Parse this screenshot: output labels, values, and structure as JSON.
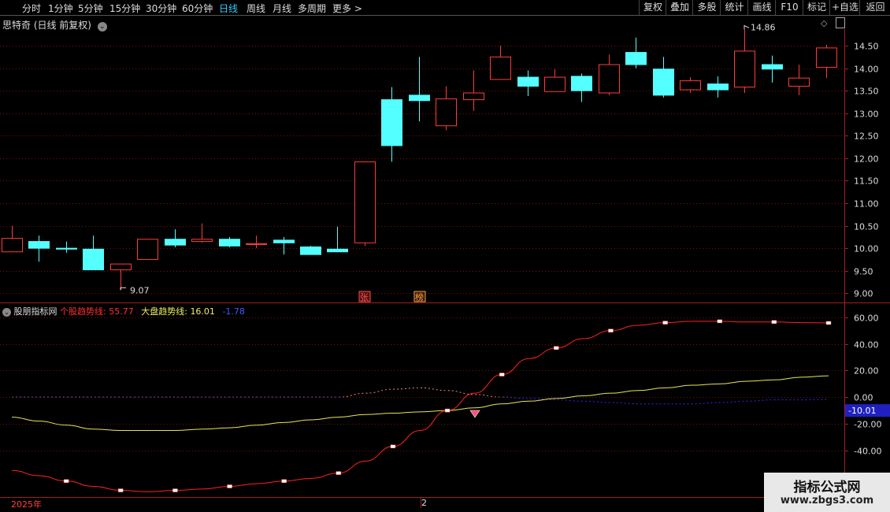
{
  "toolbar": {
    "periods": [
      "分时",
      "1分钟",
      "5分钟",
      "15分钟",
      "30分钟",
      "60分钟",
      "日线",
      "周线",
      "月线",
      "多周期",
      "更多"
    ],
    "active_period": "日线",
    "right_buttons": [
      "复权",
      "叠加",
      "多股",
      "统计",
      "画线",
      "F10",
      "标记",
      "+自选",
      "返回"
    ]
  },
  "main_chart": {
    "title": "思特奇 (日线 前复权)",
    "price_labels": [
      "14.50",
      "14.00",
      "13.50",
      "13.00",
      "12.50",
      "12.00",
      "11.50",
      "11.00",
      "10.50",
      "10.00",
      "9.50",
      "9.00"
    ],
    "high_annotation": "14.86",
    "low_annotation": "9.07",
    "markers": [
      "张",
      "榜"
    ]
  },
  "indicator": {
    "name": "股朋指标网",
    "series1_label": "个股趋势线:",
    "series1_value": "55.77",
    "series2_label": "大盘趋势线:",
    "series2_value": "16.01",
    "series3_value": "-1.78",
    "axis_labels": [
      "60.00",
      "40.00",
      "20.00",
      "0.00",
      "-20.00",
      "-40.00"
    ],
    "current_tag": "-10.01"
  },
  "date_axis": {
    "year_label": "2025年",
    "month_label": "2"
  },
  "watermark": {
    "line1": "指标公式网",
    "line2": "www.zbgs3.com"
  },
  "colors": {
    "up": "#ff3b3b",
    "down": "#54ffff",
    "stock_line": "#ff2020",
    "market_line": "#e6e65a",
    "aux_line": "#2a2aff"
  },
  "chart_data": [
    {
      "type": "candlestick",
      "ylim": [
        8.9,
        14.85
      ],
      "candles": [
        {
          "o": 9.92,
          "h": 10.5,
          "l": 9.92,
          "c": 10.22
        },
        {
          "o": 10.15,
          "h": 10.28,
          "l": 9.7,
          "c": 10.0
        },
        {
          "o": 10.0,
          "h": 10.15,
          "l": 9.9,
          "c": 9.98
        },
        {
          "o": 9.98,
          "h": 10.28,
          "l": 9.52,
          "c": 9.52
        },
        {
          "o": 9.52,
          "h": 9.65,
          "l": 9.07,
          "c": 9.65
        },
        {
          "o": 9.75,
          "h": 10.2,
          "l": 9.75,
          "c": 10.2
        },
        {
          "o": 10.2,
          "h": 10.42,
          "l": 10.02,
          "c": 10.07
        },
        {
          "o": 10.15,
          "h": 10.55,
          "l": 10.12,
          "c": 10.2
        },
        {
          "o": 10.2,
          "h": 10.25,
          "l": 10.02,
          "c": 10.05
        },
        {
          "o": 10.1,
          "h": 10.28,
          "l": 10.0,
          "c": 10.1
        },
        {
          "o": 10.18,
          "h": 10.25,
          "l": 9.86,
          "c": 10.12
        },
        {
          "o": 10.03,
          "h": 10.05,
          "l": 9.86,
          "c": 9.86
        },
        {
          "o": 9.98,
          "h": 10.48,
          "l": 9.92,
          "c": 9.92
        },
        {
          "o": 10.12,
          "h": 11.92,
          "l": 10.05,
          "c": 11.92
        },
        {
          "o": 13.3,
          "h": 13.58,
          "l": 11.92,
          "c": 12.28
        },
        {
          "o": 13.4,
          "h": 14.25,
          "l": 12.82,
          "c": 13.28
        },
        {
          "o": 12.72,
          "h": 13.6,
          "l": 12.62,
          "c": 13.32
        },
        {
          "o": 13.3,
          "h": 13.95,
          "l": 13.05,
          "c": 13.45
        },
        {
          "o": 13.75,
          "h": 14.5,
          "l": 13.75,
          "c": 14.25
        },
        {
          "o": 13.8,
          "h": 13.95,
          "l": 13.38,
          "c": 13.6
        },
        {
          "o": 13.48,
          "h": 13.98,
          "l": 13.48,
          "c": 13.8
        },
        {
          "o": 13.82,
          "h": 13.88,
          "l": 13.25,
          "c": 13.5
        },
        {
          "o": 13.45,
          "h": 14.3,
          "l": 13.4,
          "c": 14.08
        },
        {
          "o": 14.35,
          "h": 14.68,
          "l": 14.0,
          "c": 14.08
        },
        {
          "o": 13.98,
          "h": 14.25,
          "l": 13.35,
          "c": 13.4
        },
        {
          "o": 13.52,
          "h": 13.8,
          "l": 13.45,
          "c": 13.72
        },
        {
          "o": 13.65,
          "h": 13.82,
          "l": 13.35,
          "c": 13.52
        },
        {
          "o": 13.58,
          "h": 14.86,
          "l": 13.45,
          "c": 14.38
        },
        {
          "o": 14.08,
          "h": 14.28,
          "l": 13.68,
          "c": 13.98
        },
        {
          "o": 13.6,
          "h": 14.08,
          "l": 13.4,
          "c": 13.78
        },
        {
          "o": 14.02,
          "h": 14.52,
          "l": 13.78,
          "c": 14.45
        }
      ]
    },
    {
      "type": "line",
      "ylim": [
        -75,
        67
      ],
      "x": [
        0,
        1,
        2,
        3,
        4,
        5,
        6,
        7,
        8,
        9,
        10,
        11,
        12,
        13,
        14,
        15,
        16,
        17,
        18,
        19,
        20,
        21,
        22,
        23,
        24,
        25,
        26,
        27,
        28,
        29,
        30
      ],
      "series": [
        {
          "name": "个股趋势线",
          "values": [
            -55,
            -59,
            -63,
            -67,
            -70,
            -71,
            -70,
            -69,
            -67,
            -65,
            -63,
            -61,
            -57,
            -48,
            -37,
            -25,
            -10,
            3,
            17,
            29,
            37,
            44,
            50,
            54,
            56,
            57,
            57,
            56.5,
            56.5,
            56,
            55.77
          ]
        },
        {
          "name": "大盘趋势线",
          "values": [
            -15,
            -18,
            -21,
            -24,
            -25,
            -25,
            -25,
            -24,
            -23,
            -21,
            -19,
            -17,
            -15,
            -13,
            -12,
            -11,
            -10,
            -8,
            -5,
            -3,
            -1,
            1,
            3,
            5,
            7,
            9,
            10,
            12,
            13,
            15,
            16.01
          ]
        },
        {
          "name": "辅助线",
          "values": [
            0,
            0,
            0,
            0,
            0,
            0,
            0,
            0,
            0,
            0,
            0,
            0,
            0,
            3,
            6,
            7,
            5,
            2,
            0,
            -1,
            -2,
            -3,
            -4,
            -5,
            -5,
            -5,
            -4,
            -3,
            -2,
            -2,
            -1.78
          ]
        }
      ]
    }
  ]
}
